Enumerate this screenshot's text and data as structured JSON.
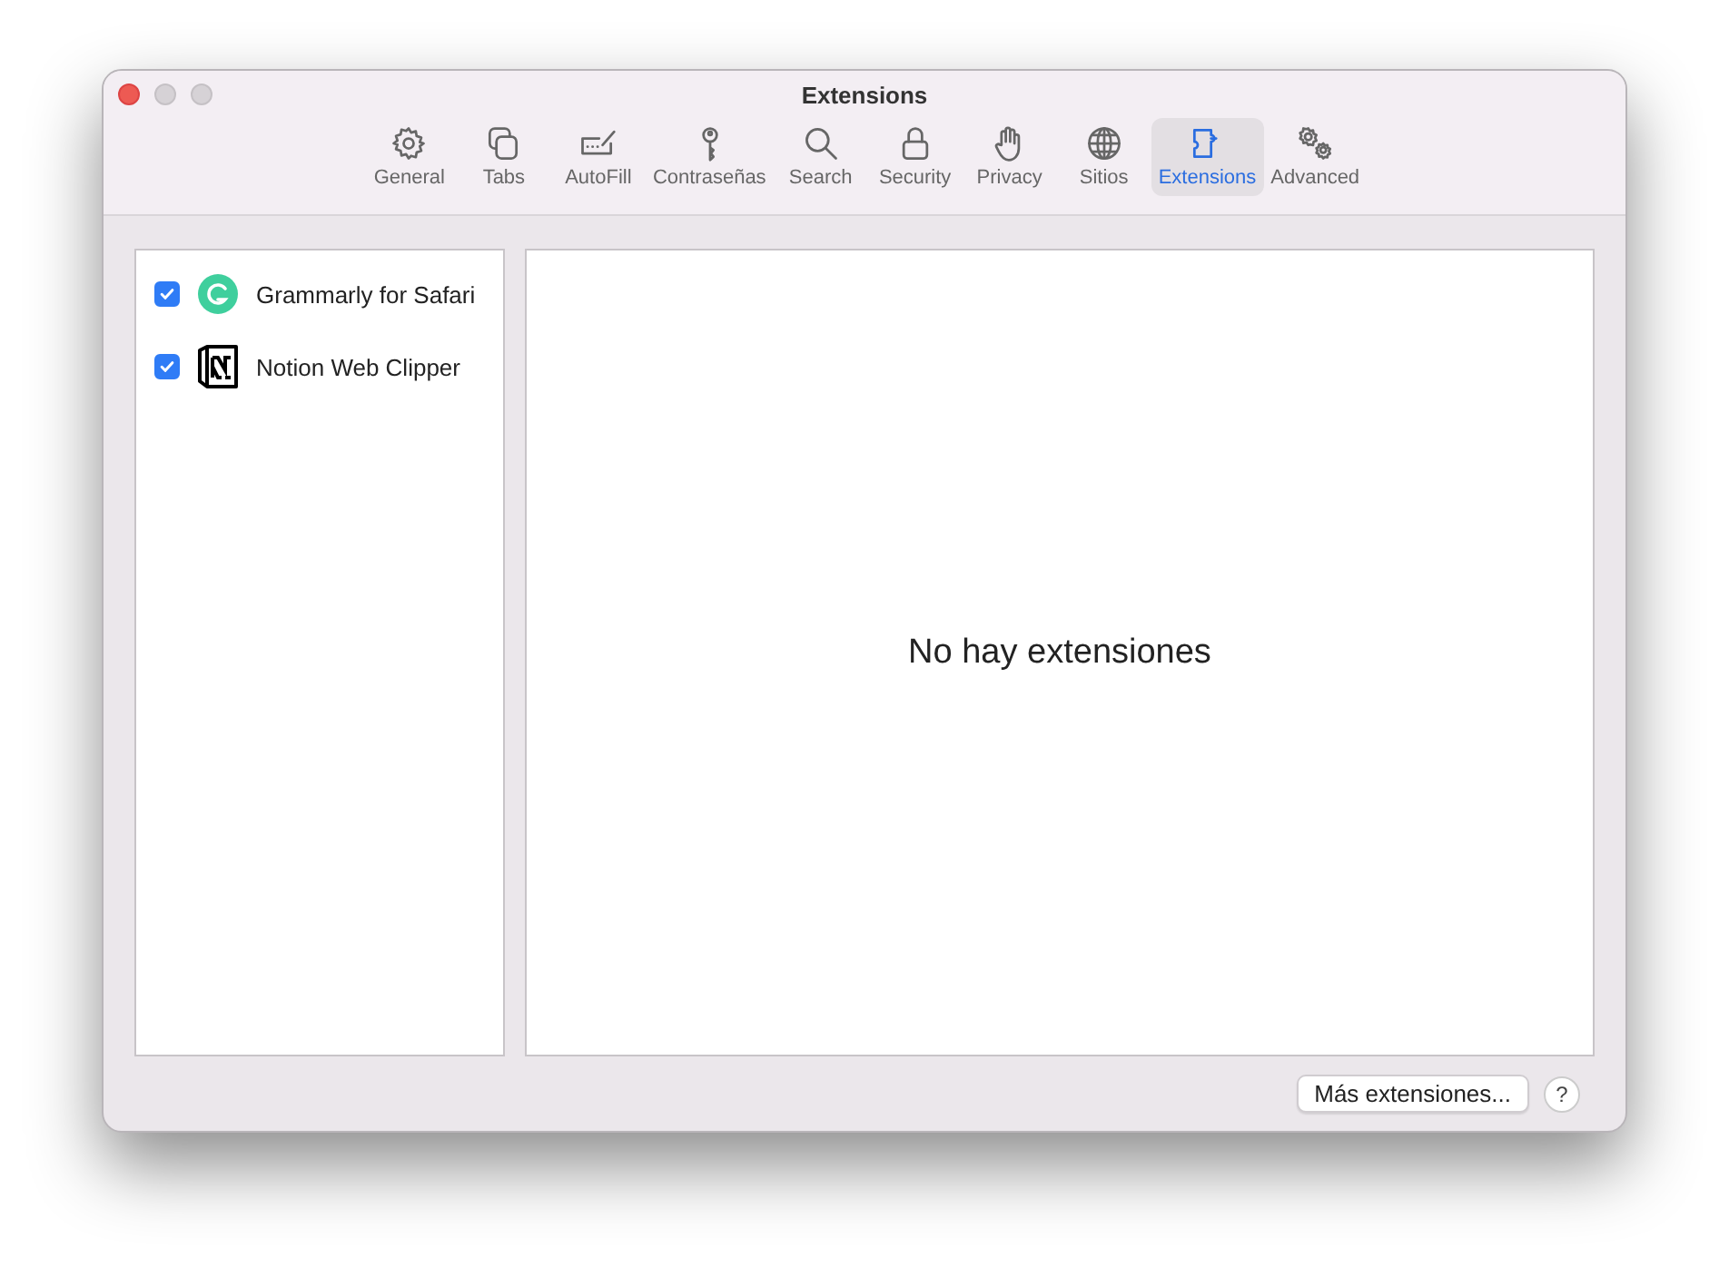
{
  "window": {
    "title": "Extensions"
  },
  "toolbar": [
    {
      "label": "General",
      "kind": "gear",
      "selected": false
    },
    {
      "label": "Tabs",
      "kind": "tabs",
      "selected": false
    },
    {
      "label": "AutoFill",
      "kind": "autofill",
      "selected": false
    },
    {
      "label": "Contraseñas",
      "kind": "key",
      "selected": false
    },
    {
      "label": "Search",
      "kind": "search",
      "selected": false
    },
    {
      "label": "Security",
      "kind": "lock",
      "selected": false
    },
    {
      "label": "Privacy",
      "kind": "hand",
      "selected": false
    },
    {
      "label": "Sitios",
      "kind": "globe",
      "selected": false
    },
    {
      "label": "Extensions",
      "kind": "puzzle",
      "selected": true
    },
    {
      "label": "Advanced",
      "kind": "gears",
      "selected": false
    }
  ],
  "extensions": [
    {
      "name": "Grammarly for Safari",
      "kind": "grammarly",
      "checked": true
    },
    {
      "name": "Notion Web Clipper",
      "kind": "notion",
      "checked": true
    }
  ],
  "detail": {
    "message": "No hay extensiones"
  },
  "buttons": {
    "more": "Más extensiones...",
    "help": "?"
  }
}
